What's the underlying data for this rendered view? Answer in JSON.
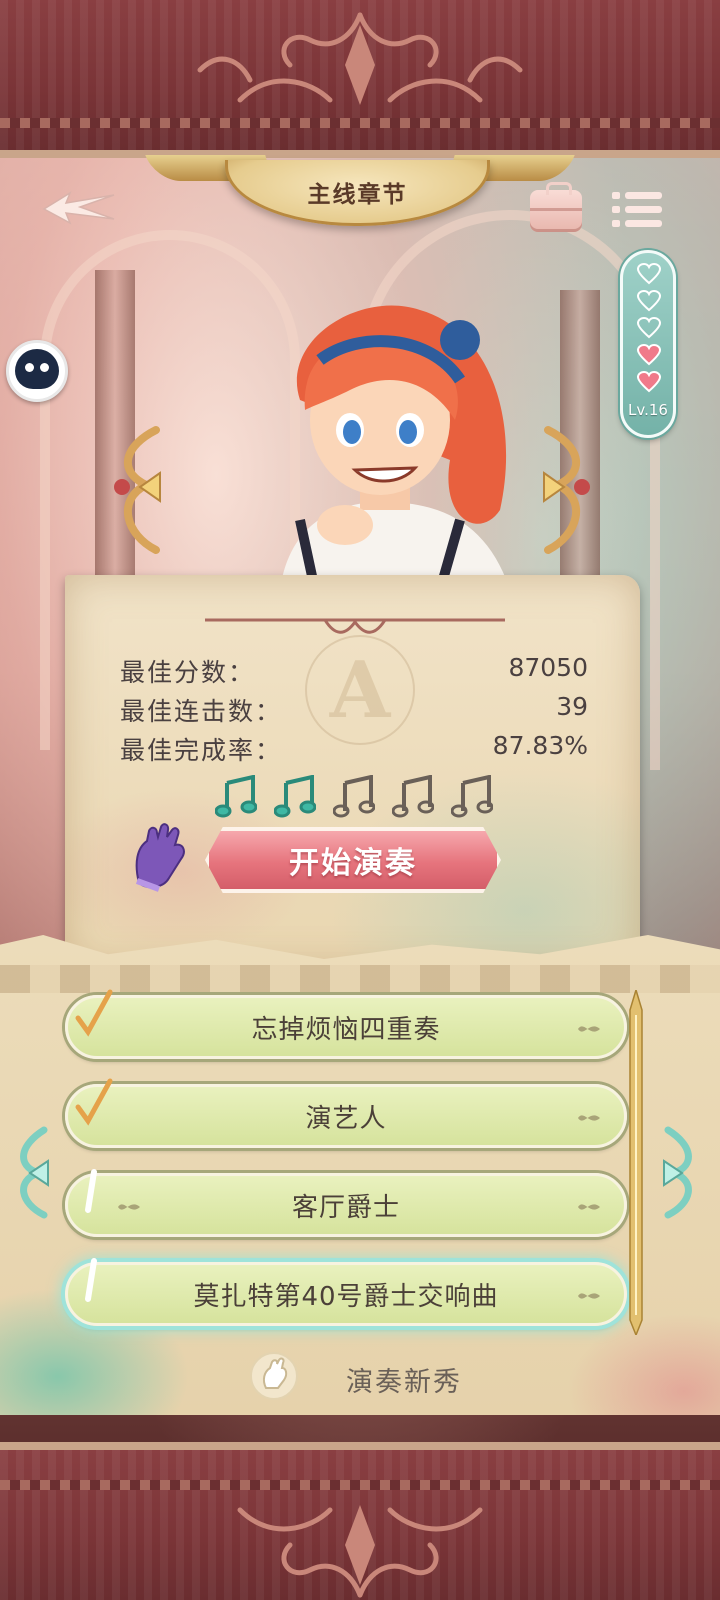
{
  "header": {
    "chapter_title": "主线章节"
  },
  "hearts": {
    "filled": 2,
    "total": 5,
    "level": "Lv.16"
  },
  "stats": {
    "best_score_label": "最佳分数：",
    "best_score": "87050",
    "best_combo_label": "最佳连击数：",
    "best_combo": "39",
    "best_completion_label": "最佳完成率：",
    "best_completion": "87.83%",
    "grade_emblem": "A",
    "notes_earned": 2,
    "notes_total": 5
  },
  "actions": {
    "start_label": "开始演奏"
  },
  "songs": [
    {
      "title": "忘掉烦恼四重奏",
      "status": "completed"
    },
    {
      "title": "演艺人",
      "status": "completed"
    },
    {
      "title": "客厅爵士",
      "status": "in-progress"
    },
    {
      "title": "莫扎特第40号爵士交响曲",
      "status": "in-progress",
      "selected": true
    }
  ],
  "difficulty": {
    "label": "演奏新秀"
  },
  "colors": {
    "band": "#7a3437",
    "accent_teal": "#74b2a8",
    "start_button": "#e6747d",
    "song_row": "#d6e39d",
    "heart_filled": "#f07a8a"
  },
  "icons": {
    "back": "winged-arrow-back-icon",
    "bag": "briefcase-icon",
    "menu": "list-menu-icon",
    "glove": "purple-glove-icon",
    "note": "music-note-icon",
    "check": "checkmark-icon",
    "rookie": "rookie-hand-icon"
  }
}
